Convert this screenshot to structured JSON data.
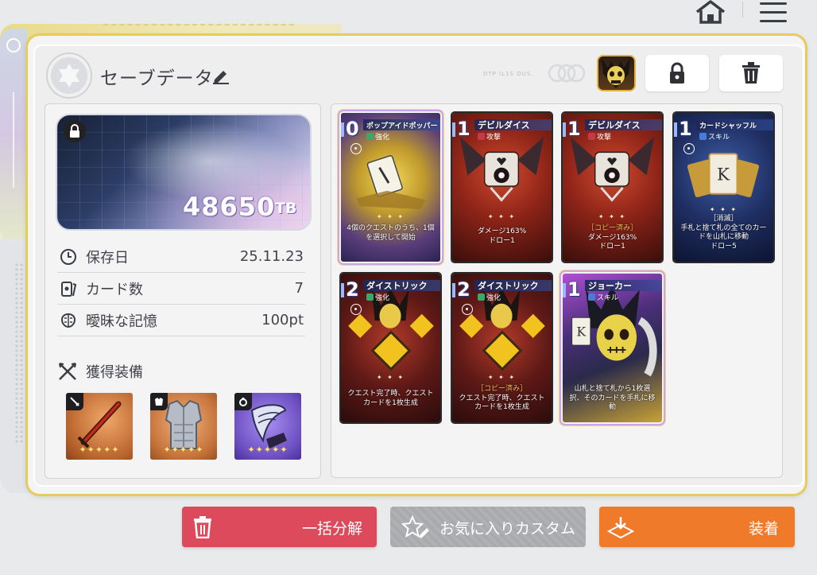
{
  "header": {
    "title": "セーブデータ",
    "faint_label": "DTP IL1S DUS."
  },
  "tb": {
    "value": "48650",
    "unit": "TB"
  },
  "stats": [
    {
      "label": "保存日",
      "value": "25.11.23",
      "icon": "clock-icon"
    },
    {
      "label": "カード数",
      "value": "7",
      "icon": "cards-icon"
    },
    {
      "label": "曖昧な記憶",
      "value": "100pt",
      "icon": "brain-icon"
    }
  ],
  "equipment": {
    "label": "獲得装備",
    "items": [
      {
        "type": "weapon",
        "icon": "sword-icon",
        "stars": "✦✦✦✦✦"
      },
      {
        "type": "armor",
        "icon": "armor-icon",
        "stars": "✦✦✦✦✦"
      },
      {
        "type": "accessory",
        "icon": "ring-icon",
        "stars": "✦✦✦✦✦"
      }
    ]
  },
  "cards": [
    {
      "cost": "0",
      "name": "ポップアイドポッパー",
      "type": "強化",
      "desc": "4個のクエストのうち、1個を選択して開始",
      "copy": "",
      "consume": "",
      "divider": "✦ ✦ ✦"
    },
    {
      "cost": "1",
      "name": "デビルダイス",
      "type": "攻撃",
      "desc": "ダメージ163%\nドロー1",
      "copy": "",
      "consume": "",
      "divider": "✦ ✦ ✦"
    },
    {
      "cost": "1",
      "name": "デビルダイス",
      "type": "攻撃",
      "desc": "ダメージ163%\nドロー1",
      "copy": "［コピー済み］",
      "consume": "",
      "divider": "✦ ✦ ✦"
    },
    {
      "cost": "1",
      "name": "カードシャッフル",
      "type": "スキル",
      "desc": "手札と捨て札の全てのカードを山札に移動\nドロー5",
      "copy": "",
      "consume": "［消滅］",
      "divider": "✦ ✦ ✦"
    },
    {
      "cost": "2",
      "name": "ダイストリック",
      "type": "強化",
      "desc": "クエスト完了時、クエストカードを1枚生成",
      "copy": "",
      "consume": "",
      "divider": "✦ ✦ ✦"
    },
    {
      "cost": "2",
      "name": "ダイストリック",
      "type": "強化",
      "desc": "クエスト完了時、クエストカードを1枚生成",
      "copy": "［コピー済み］",
      "consume": "",
      "divider": "✦ ✦ ✦"
    },
    {
      "cost": "1",
      "name": "ジョーカー",
      "type": "スキル",
      "desc": "山札と捨て札から1枚選択、そのカードを手札に移動",
      "copy": "",
      "consume": "",
      "divider": "✦ ✦ ✦"
    }
  ],
  "buttons": {
    "bulk_dismantle": "一括分解",
    "favorite_custom": "お気に入りカスタム",
    "equip": "装着"
  },
  "colors": {
    "accent_gold": "#e6cc5c",
    "danger": "#dc4a5c",
    "primary": "#ef7a2a",
    "disabled": "#a9aaad"
  }
}
